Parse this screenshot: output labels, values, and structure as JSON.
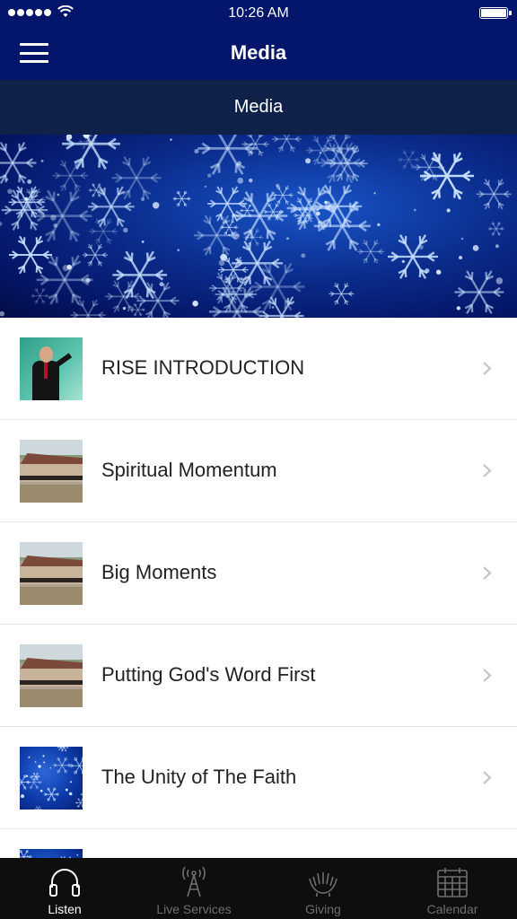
{
  "status_bar": {
    "time": "10:26 AM"
  },
  "nav": {
    "title": "Media"
  },
  "section_header": {
    "title": "Media"
  },
  "media_items": [
    {
      "title": "RISE INTRODUCTION",
      "thumbnail": "speaker-photo"
    },
    {
      "title": "Spiritual Momentum",
      "thumbnail": "church-building-photo"
    },
    {
      "title": "Big Moments",
      "thumbnail": "church-building-photo"
    },
    {
      "title": "Putting God's Word First",
      "thumbnail": "church-building-photo"
    },
    {
      "title": "The Unity of The Faith",
      "thumbnail": "blue-snowflake-photo"
    },
    {
      "title": "",
      "thumbnail": "blue-snowflake-photo"
    }
  ],
  "tabs": [
    {
      "label": "Listen",
      "icon": "headphones-icon",
      "active": true
    },
    {
      "label": "Live Services",
      "icon": "broadcast-tower-icon",
      "active": false
    },
    {
      "label": "Giving",
      "icon": "giving-hands-icon",
      "active": false
    },
    {
      "label": "Calendar",
      "icon": "calendar-icon",
      "active": false
    }
  ],
  "colors": {
    "nav_background": "#03166b",
    "section_header_background": "#0f2049",
    "tab_bar_background": "#0e0e0e",
    "tab_active": "#ffffff",
    "tab_inactive": "#6f6f6f"
  }
}
